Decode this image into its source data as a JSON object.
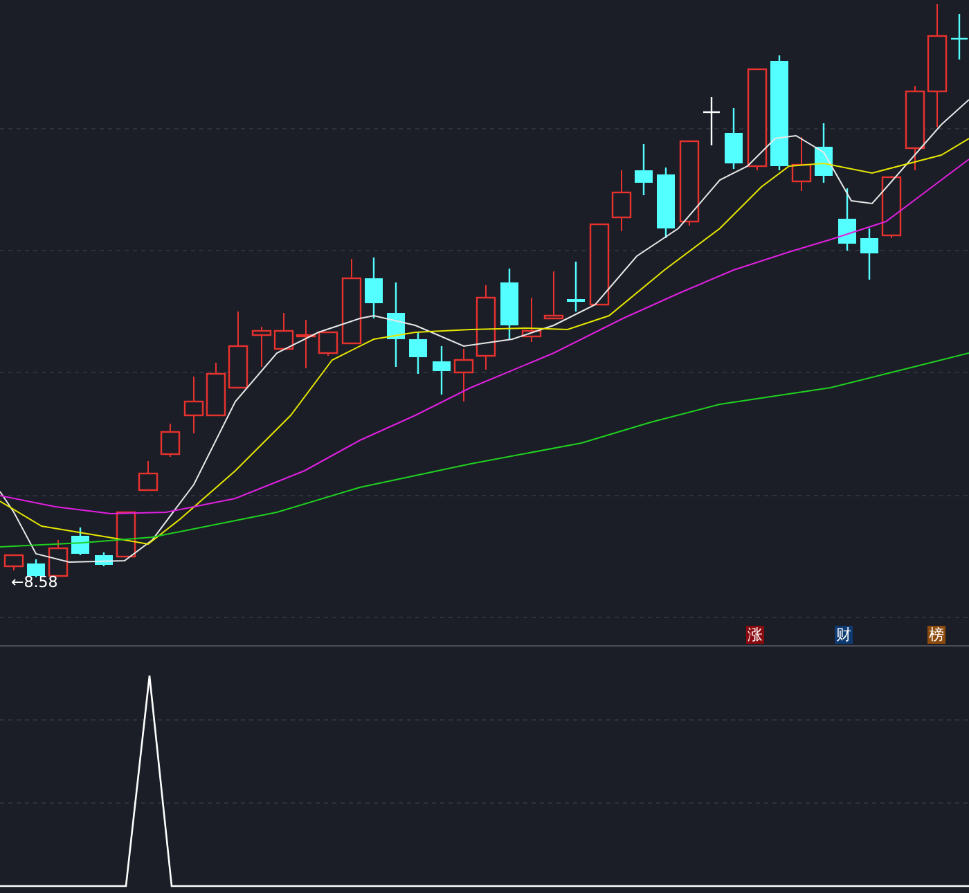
{
  "main_chart": {
    "low_marker": "←8.58"
  },
  "badges": [
    {
      "label": "涨",
      "color": "#8b0a0f"
    },
    {
      "label": "财",
      "color": "#0e3a72"
    },
    {
      "label": "榜",
      "color": "#8c4a0c"
    }
  ]
}
